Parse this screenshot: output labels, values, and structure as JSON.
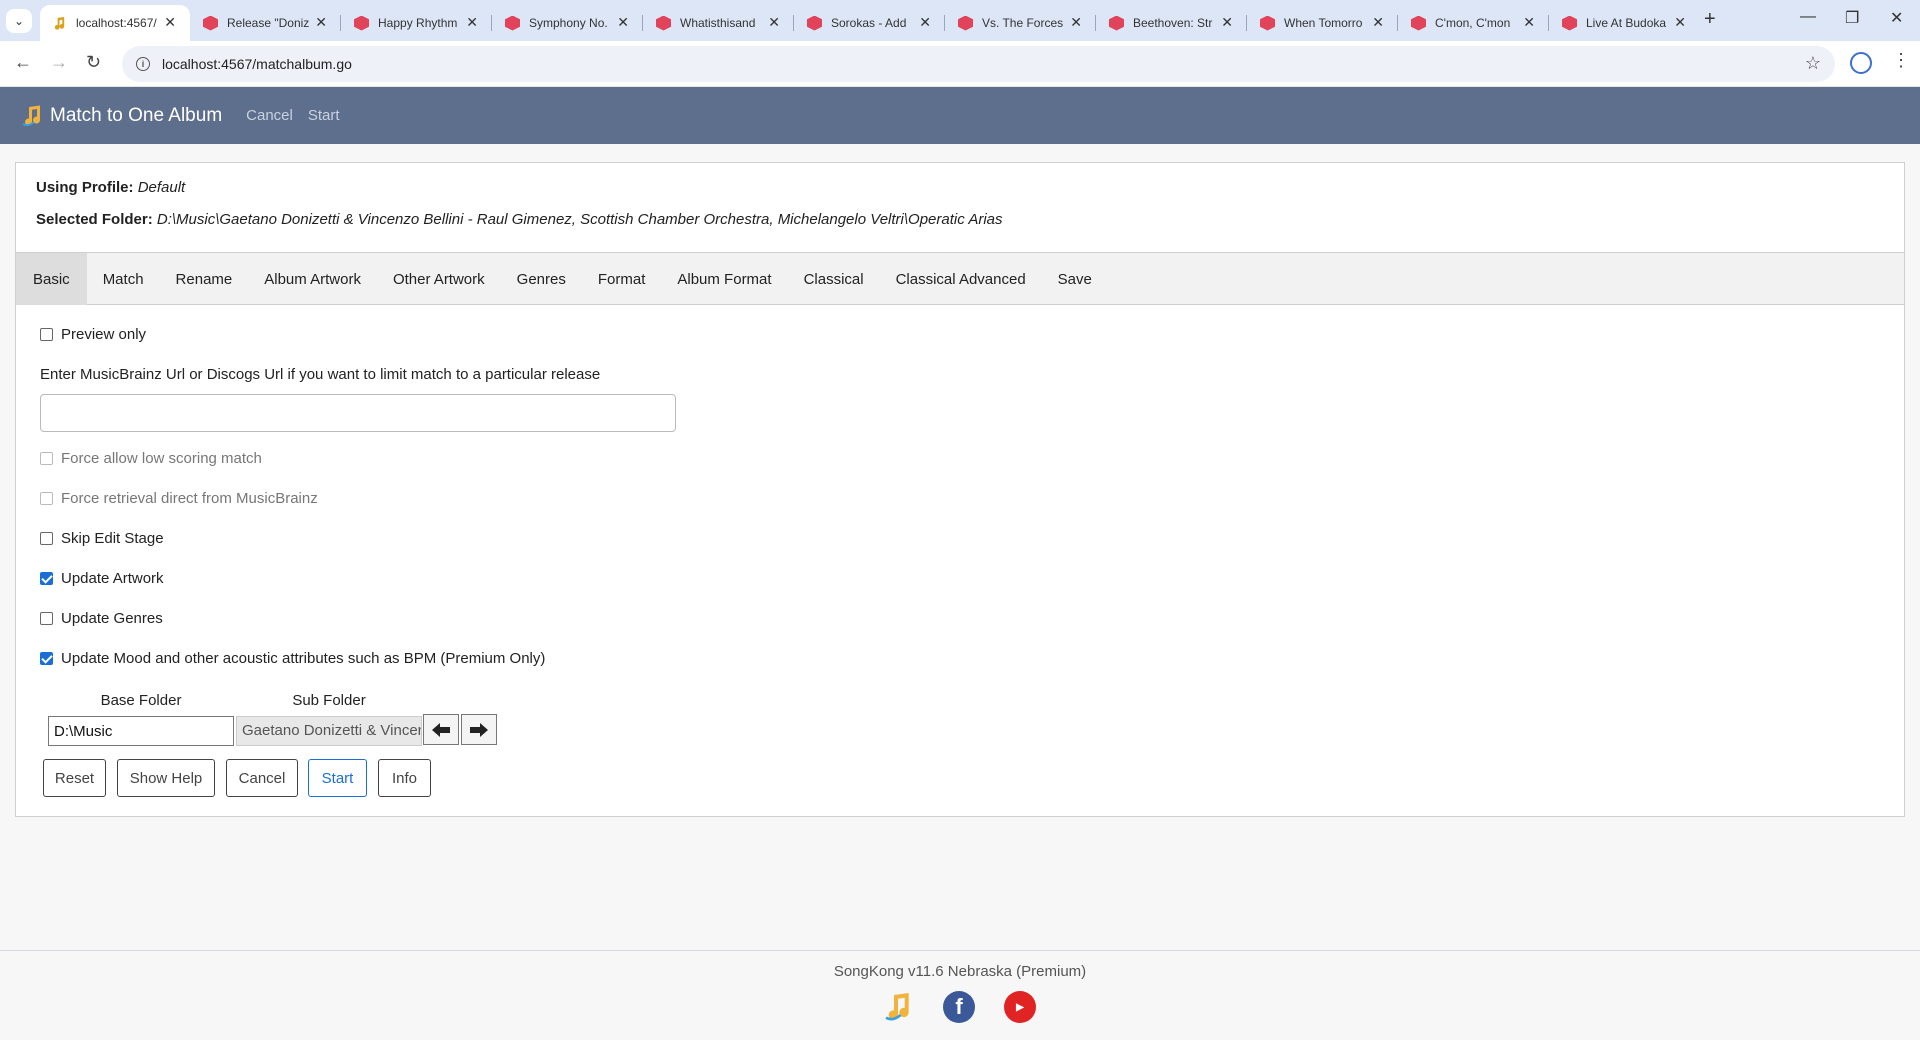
{
  "browser": {
    "tabs": [
      {
        "title": "localhost:4567/",
        "active": true
      },
      {
        "title": "Release \"Doniz"
      },
      {
        "title": "Happy Rhythm"
      },
      {
        "title": "Symphony No."
      },
      {
        "title": "Whatisthisand"
      },
      {
        "title": "Sorokas - Add"
      },
      {
        "title": "Vs. The Forces"
      },
      {
        "title": "Beethoven: Str"
      },
      {
        "title": "When Tomorro"
      },
      {
        "title": "C'mon, C'mon"
      },
      {
        "title": "Live At Budoka"
      }
    ],
    "url": "localhost:4567/matchalbum.go"
  },
  "header": {
    "title": "Match to One Album",
    "nav": [
      "Cancel",
      "Start"
    ]
  },
  "info": {
    "profile_label": "Using Profile:",
    "profile_value": "Default",
    "folder_label": "Selected Folder:",
    "folder_value": "D:\\Music\\Gaetano Donizetti & Vincenzo Bellini - Raul Gimenez, Scottish Chamber Orchestra, Michelangelo Veltri\\Operatic Arias"
  },
  "tabs": [
    "Basic",
    "Match",
    "Rename",
    "Album Artwork",
    "Other Artwork",
    "Genres",
    "Format",
    "Album Format",
    "Classical",
    "Classical Advanced",
    "Save"
  ],
  "active_tab": "Basic",
  "form": {
    "preview_only": {
      "label": "Preview only",
      "checked": false
    },
    "url_prompt": "Enter MusicBrainz Url or Discogs Url if you want to limit match to a particular release",
    "url_value": "",
    "force_low_score": {
      "label": "Force allow low scoring match",
      "checked": false,
      "disabled": true
    },
    "force_retrieval": {
      "label": "Force retrieval direct from MusicBrainz",
      "checked": false,
      "disabled": true
    },
    "skip_edit": {
      "label": "Skip Edit Stage",
      "checked": false
    },
    "update_artwork": {
      "label": "Update Artwork",
      "checked": true
    },
    "update_genres": {
      "label": "Update Genres",
      "checked": false
    },
    "update_mood": {
      "label": "Update Mood and other acoustic attributes such as BPM (Premium Only)",
      "checked": true
    },
    "base_folder_label": "Base Folder",
    "sub_folder_label": "Sub Folder",
    "base_folder_value": "D:\\Music",
    "sub_folder_value": "Gaetano Donizetti & Vincen"
  },
  "buttons": {
    "reset": "Reset",
    "show_help": "Show Help",
    "cancel": "Cancel",
    "start": "Start",
    "info": "Info"
  },
  "footer": {
    "version": "SongKong v11.6 Nebraska (Premium)"
  },
  "colors": {
    "appbar": "#5d6f8c",
    "accent": "#1a6fd6"
  }
}
